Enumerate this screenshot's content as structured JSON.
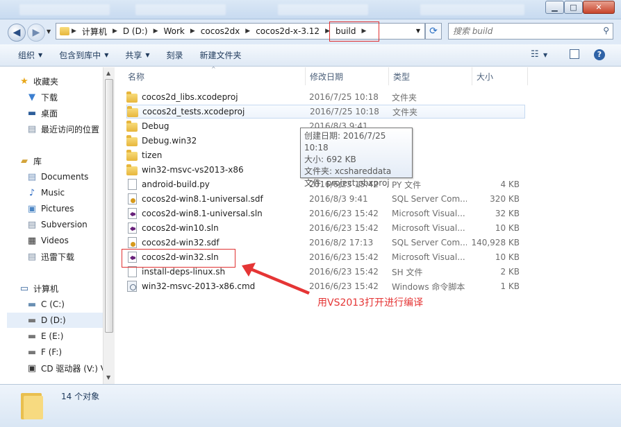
{
  "title_bar": {
    "minimize": "▁",
    "maximize": "□",
    "close": "✕"
  },
  "address": {
    "breadcrumbs": [
      "计算机",
      "D (D:)",
      "Work",
      "cocos2dx",
      "cocos2d-x-3.12",
      "build"
    ],
    "search_placeholder": "搜索 build"
  },
  "toolbar": {
    "organize": "组织",
    "include_in_library": "包含到库中",
    "share": "共享",
    "burn": "刻录",
    "new_folder": "新建文件夹"
  },
  "sidebar": {
    "favorites": {
      "label": "收藏夹",
      "items": [
        "下载",
        "桌面",
        "最近访问的位置"
      ]
    },
    "libraries": {
      "label": "库",
      "items": [
        "Documents",
        "Music",
        "Pictures",
        "Subversion",
        "Videos",
        "迅雷下载"
      ]
    },
    "computer": {
      "label": "计算机",
      "items": [
        "C (C:)",
        "D (D:)",
        "E (E:)",
        "F (F:)",
        "CD 驱动器 (V:) V"
      ]
    }
  },
  "columns": {
    "name": "名称",
    "date": "修改日期",
    "type": "类型",
    "size": "大小"
  },
  "files": [
    {
      "name": "cocos2d_libs.xcodeproj",
      "date": "2016/7/25 10:18",
      "type": "文件夹",
      "size": "",
      "icon": "folder"
    },
    {
      "name": "cocos2d_tests.xcodeproj",
      "date": "2016/7/25 10:18",
      "type": "文件夹",
      "size": "",
      "icon": "folder"
    },
    {
      "name": "Debug",
      "date": "2016/8/3 9:41",
      "type": "",
      "size": "",
      "icon": "folder"
    },
    {
      "name": "Debug.win32",
      "date": "",
      "type": "夹",
      "size": "",
      "icon": "folder"
    },
    {
      "name": "tizen",
      "date": "",
      "type": "夹",
      "size": "",
      "icon": "folder"
    },
    {
      "name": "win32-msvc-vs2013-x86",
      "date": "",
      "type": "夹",
      "size": "",
      "icon": "folder"
    },
    {
      "name": "android-build.py",
      "date": "2016/6/23 15:42",
      "type": "PY 文件",
      "size": "4 KB",
      "icon": "file"
    },
    {
      "name": "cocos2d-win8.1-universal.sdf",
      "date": "2016/8/3 9:41",
      "type": "SQL Server Com...",
      "size": "320 KB",
      "icon": "sql"
    },
    {
      "name": "cocos2d-win8.1-universal.sln",
      "date": "2016/6/23 15:42",
      "type": "Microsoft Visual...",
      "size": "32 KB",
      "icon": "vs"
    },
    {
      "name": "cocos2d-win10.sln",
      "date": "2016/6/23 15:42",
      "type": "Microsoft Visual...",
      "size": "10 KB",
      "icon": "vs"
    },
    {
      "name": "cocos2d-win32.sdf",
      "date": "2016/8/2 17:13",
      "type": "SQL Server Com...",
      "size": "140,928 KB",
      "icon": "sql"
    },
    {
      "name": "cocos2d-win32.sln",
      "date": "2016/6/23 15:42",
      "type": "Microsoft Visual...",
      "size": "10 KB",
      "icon": "vs"
    },
    {
      "name": "install-deps-linux.sh",
      "date": "2016/6/23 15:42",
      "type": "SH 文件",
      "size": "2 KB",
      "icon": "file"
    },
    {
      "name": "win32-msvc-2013-x86.cmd",
      "date": "2016/6/23 15:42",
      "type": "Windows 命令脚本",
      "size": "1 KB",
      "icon": "cmd"
    }
  ],
  "tooltip": {
    "line1": "创建日期: 2016/7/25 10:18",
    "line2": "大小: 692 KB",
    "line3": "文件夹: xcshareddata",
    "line4": "文件: project.pbxproj"
  },
  "annotation": "用VS2013打开进行编译",
  "status": {
    "count": "14 个对象"
  },
  "colors": {
    "annotation_red": "#e53535",
    "selection_blue": "#c5d9f1"
  }
}
